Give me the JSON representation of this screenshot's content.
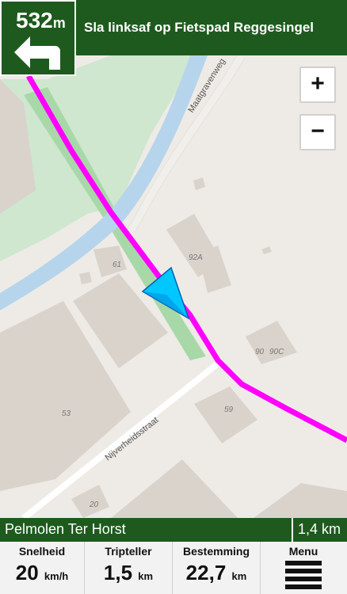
{
  "turn": {
    "distance_value": "532",
    "distance_unit": "m",
    "icon": "turn-left-arrow-icon"
  },
  "instruction": {
    "text": "Sla linksaf op Fietspad Reggesingel"
  },
  "zoom": {
    "in_label": "+",
    "out_label": "−"
  },
  "map": {
    "street_labels": [
      "Maatgravenweg",
      "Nijverheidsstraat"
    ],
    "house_numbers": [
      "61",
      "92A",
      "90",
      "90C",
      "53",
      "59",
      "20"
    ],
    "route_color": "#ff00ff",
    "position_marker_color": "#00c8ff"
  },
  "destination": {
    "name": "Pelmolen Ter Horst",
    "distance": "1,4 km"
  },
  "stats": {
    "speed": {
      "label": "Snelheid",
      "value": "20",
      "unit": "km/h"
    },
    "trip": {
      "label": "Tripteller",
      "value": "1,5",
      "unit": "km"
    },
    "dest": {
      "label": "Bestemming",
      "value": "22,7",
      "unit": "km"
    },
    "menu": {
      "label": "Menu",
      "icon": "hamburger-menu-icon"
    }
  },
  "colors": {
    "bar_green": "#1e5a1e"
  }
}
